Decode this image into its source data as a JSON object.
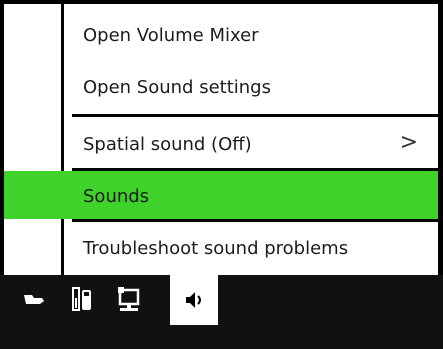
{
  "menu": {
    "items": [
      {
        "label": "Open Volume Mixer"
      },
      {
        "label": "Open Sound settings"
      },
      {
        "label": "Spatial sound (Off)",
        "submenu_glyph": ">"
      },
      {
        "label": "Sounds",
        "highlighted": true
      },
      {
        "label": "Troubleshoot sound problems"
      }
    ]
  },
  "taskbar": {
    "icons": [
      "show-hidden-icons-icon",
      "battery-icon",
      "network-icon",
      "volume-icon"
    ]
  },
  "colors": {
    "highlight": "#3ed22a",
    "taskbar": "#111111",
    "border": "#000000"
  }
}
